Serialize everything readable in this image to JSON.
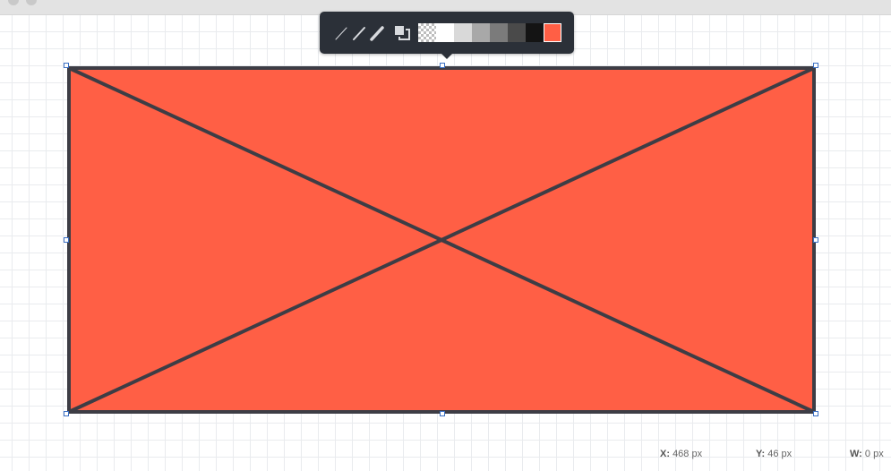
{
  "toolbar": {
    "line_styles": [
      "thin-line-icon",
      "medium-line-icon",
      "thick-line-icon"
    ],
    "arrange_icon": "send-backward-icon",
    "swatches": [
      {
        "name": "transparent",
        "color": "transparent"
      },
      {
        "name": "white",
        "color": "#ffffff"
      },
      {
        "name": "light-gray",
        "color": "#d9d9d9"
      },
      {
        "name": "gray",
        "color": "#a8a8a8"
      },
      {
        "name": "dark-gray",
        "color": "#7b7b7b"
      },
      {
        "name": "charcoal",
        "color": "#4a4a4a"
      },
      {
        "name": "black",
        "color": "#141414"
      },
      {
        "name": "coral",
        "color": "#ff5f45"
      }
    ]
  },
  "shape": {
    "type": "placeholder-box",
    "fill": "#ff5f45",
    "stroke": "#3d3d45"
  },
  "status": {
    "x_label": "X:",
    "x_value": "468 px",
    "y_label": "Y:",
    "y_value": "46 px",
    "w_label": "W:",
    "w_value": "0 px"
  }
}
